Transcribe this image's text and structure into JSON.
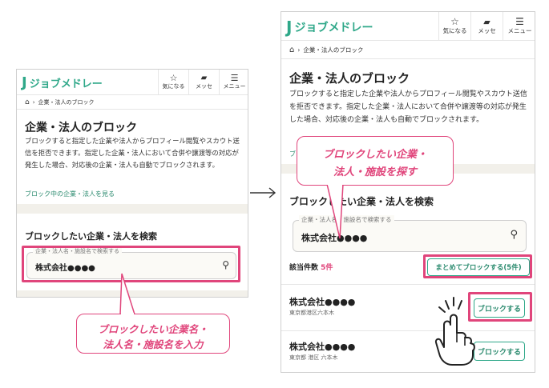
{
  "app": {
    "logo_text": "ジョブメドレー"
  },
  "header": {
    "favorites_label": "気になる",
    "messages_label": "メッセ",
    "menu_label": "メニュー"
  },
  "breadcrumb": {
    "current": "企業・法人のブロック"
  },
  "page": {
    "title": "企業・法人のブロック",
    "description": "ブロックすると指定した企業や法人からプロフィール閲覧やスカウト送信を拒否できます。指定した企業・法人において合併や譲渡等の対応が発生した場合、対応後の企業・法人も自動でブロックされます。",
    "blocked_list_link": "ブロック中の企業・法人を見る",
    "blocked_list_link_partial": "ブロ"
  },
  "search": {
    "section_title": "ブロックしたい企業・法人を検索",
    "placeholder": "企業・法人名・施設名で検索する",
    "value": "株式会社●●●●"
  },
  "results": {
    "count_label": "該当件数",
    "count_value": "5件",
    "bulk_block_label": "まとめてブロックする(5件)",
    "items": [
      {
        "name": "株式会社●●●●",
        "address": "東京都港区六本木",
        "block_label": "ブロックする"
      },
      {
        "name": "株式会社●●●●",
        "address": "東京都 港区 六本木",
        "block_label": "ブロックする"
      }
    ]
  },
  "callouts": {
    "left_line1": "ブロックしたい企業名・",
    "left_line2": "法人名・施設名を入力",
    "right_line1": "ブロックしたい企業・",
    "right_line2": "法人・施設を探す"
  },
  "colors": {
    "brand": "#2fa889",
    "accent": "#e0457b"
  },
  "icons": {
    "star": "star-icon",
    "message": "message-icon",
    "menu": "hamburger-icon",
    "home": "home-icon",
    "search": "search-icon",
    "hand": "pointing-hand-icon"
  }
}
